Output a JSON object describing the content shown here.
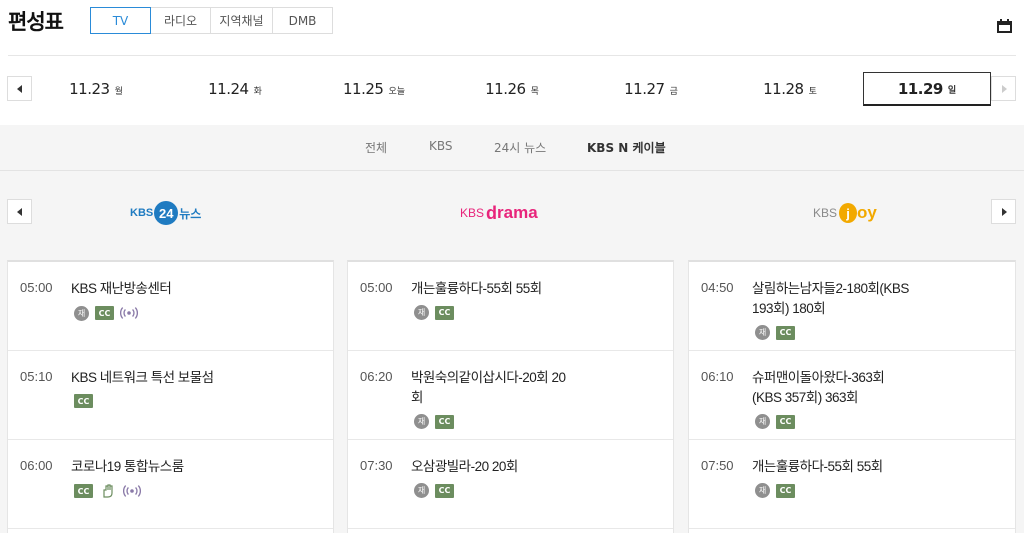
{
  "header": {
    "title": "편성표",
    "media_tabs": [
      "TV",
      "라디오",
      "지역채널",
      "DMB"
    ],
    "active_media_tab": "TV"
  },
  "dates": [
    {
      "date": "11.23",
      "weekday": "월"
    },
    {
      "date": "11.24",
      "weekday": "화"
    },
    {
      "date": "11.25",
      "weekday": "오늘"
    },
    {
      "date": "11.26",
      "weekday": "목"
    },
    {
      "date": "11.27",
      "weekday": "금"
    },
    {
      "date": "11.28",
      "weekday": "토"
    },
    {
      "date": "11.29",
      "weekday": "일"
    }
  ],
  "active_date": "11.29",
  "filters": [
    "전체",
    "KBS",
    "24시 뉴스",
    "KBS N 케이블"
  ],
  "active_filter": "KBS N 케이블",
  "channels": [
    {
      "logo_prefix": "KBS",
      "logo_mark": "24",
      "logo_suffix": "뉴스",
      "color": "#1f7bc1"
    },
    {
      "logo_prefix": "KBS",
      "logo_mark": "d",
      "logo_suffix": "rama",
      "color": "#e8247b"
    },
    {
      "logo_prefix": "KBS",
      "logo_mark": "j",
      "logo_suffix": "oy",
      "color": "#f2a900"
    }
  ],
  "badge_labels": {
    "rerun": "재",
    "cc": "CC"
  },
  "programs": [
    [
      {
        "time": "05:00",
        "title": "KBS 재난방송센터",
        "badges": [
          "rerun",
          "cc",
          "broadcast"
        ]
      },
      {
        "time": "05:10",
        "title": "KBS 네트워크 특선 보물섬",
        "badges": [
          "cc"
        ]
      },
      {
        "time": "06:00",
        "title": "코로나19 통합뉴스룸",
        "badges": [
          "cc",
          "sign-language",
          "broadcast"
        ]
      }
    ],
    [
      {
        "time": "05:00",
        "title": "개는훌륭하다-55회 55회",
        "badges": [
          "rerun",
          "cc"
        ]
      },
      {
        "time": "06:20",
        "title": "박원숙의같이삽시다-20회 20회",
        "badges": [
          "rerun",
          "cc"
        ]
      },
      {
        "time": "07:30",
        "title": "오삼광빌라-20 20회",
        "badges": [
          "rerun",
          "cc"
        ]
      }
    ],
    [
      {
        "time": "04:50",
        "title": "살림하는남자들2-180회(KBS 193회) 180회",
        "badges": [
          "rerun",
          "cc"
        ]
      },
      {
        "time": "06:10",
        "title": "슈퍼맨이돌아왔다-363회(KBS 357회) 363회",
        "badges": [
          "rerun",
          "cc"
        ]
      },
      {
        "time": "07:50",
        "title": "개는훌륭하다-55회 55회",
        "badges": [
          "rerun",
          "cc"
        ]
      }
    ]
  ],
  "icons": {
    "calendar": "calendar-icon",
    "prev": "chevron-left-icon",
    "next": "chevron-right-icon",
    "broadcast": "broadcast-icon",
    "sign_language": "sign-language-icon"
  },
  "colors": {
    "accent": "#2a8bd8",
    "cc_badge": "#6c8d5f",
    "rerun_badge": "#8f8f8f",
    "gray_bg": "#f5f5f5"
  }
}
